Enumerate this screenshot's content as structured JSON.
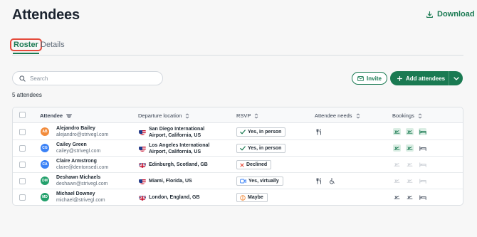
{
  "page": {
    "title": "Attendees",
    "download_label": "Download"
  },
  "tabs": [
    {
      "label": "Roster",
      "active": true
    },
    {
      "label": "Details",
      "active": false
    }
  ],
  "search": {
    "placeholder": "Search",
    "value": ""
  },
  "actions": {
    "invite_label": "Invite",
    "add_label": "Add attendees"
  },
  "summary": {
    "count_text": "5 attendees"
  },
  "table": {
    "headers": {
      "attendee": "Attendee",
      "departure": "Departure location",
      "rsvp": "RSVP",
      "needs": "Attendee needs",
      "bookings": "Bookings"
    },
    "rows": [
      {
        "initials": "AB",
        "avatar_color": "#f28b3b",
        "name": "Alejandro Bailey",
        "email": "alejandro@strivegl.com",
        "flag": "us",
        "location_line1": "San Diego International",
        "location_line2": "Airport, California, US",
        "rsvp": "Yes, in person",
        "rsvp_icon": "check-icon",
        "needs": [
          "fork-knife-icon"
        ],
        "bookings": [
          "flight-green",
          "flight-green",
          "hotel-green"
        ]
      },
      {
        "initials": "CG",
        "avatar_color": "#3b82f6",
        "name": "Cailey Green",
        "email": "cailey@strivegl.com",
        "flag": "us",
        "location_line1": "Los Angeles International",
        "location_line2": "Airport, California, US",
        "rsvp": "Yes, in person",
        "rsvp_icon": "check-icon",
        "needs": [],
        "bookings": [
          "flight-green",
          "flight-green",
          "hotel-gray"
        ]
      },
      {
        "initials": "CA",
        "avatar_color": "#3b82f6",
        "name": "Claire Armstrong",
        "email": "claire@dentonsedi.com",
        "flag": "gb",
        "location_line1": "Edinburgh, Scotland, GB",
        "location_line2": "",
        "rsvp": "Declined",
        "rsvp_icon": "x-icon",
        "needs": [],
        "bookings": [
          "flight-faded",
          "flight-faded",
          "hotel-faded"
        ]
      },
      {
        "initials": "DM",
        "avatar_color": "#22a06b",
        "name": "Deshawn Michaels",
        "email": "deshawn@strivegl.com",
        "flag": "us",
        "location_line1": "Miami, Florida, US",
        "location_line2": "",
        "rsvp": "Yes, virtually",
        "rsvp_icon": "video-icon",
        "needs": [
          "fork-knife-icon",
          "wheelchair-icon"
        ],
        "bookings": [
          "flight-faded",
          "flight-faded",
          "hotel-faded"
        ]
      },
      {
        "initials": "MD",
        "avatar_color": "#22a06b",
        "name": "Michael Downey",
        "email": "michael@strivegl.com",
        "flag": "gb",
        "location_line1": "London, England, GB",
        "location_line2": "",
        "rsvp": "Maybe",
        "rsvp_icon": "maybe-icon",
        "needs": [],
        "bookings": [
          "flight-gray",
          "flight-gray",
          "hotel-gray"
        ]
      }
    ]
  },
  "colors": {
    "brand_green": "#1a7a52",
    "focus_red": "#e54b3c",
    "booking_green_bg": "#dbeee4"
  }
}
